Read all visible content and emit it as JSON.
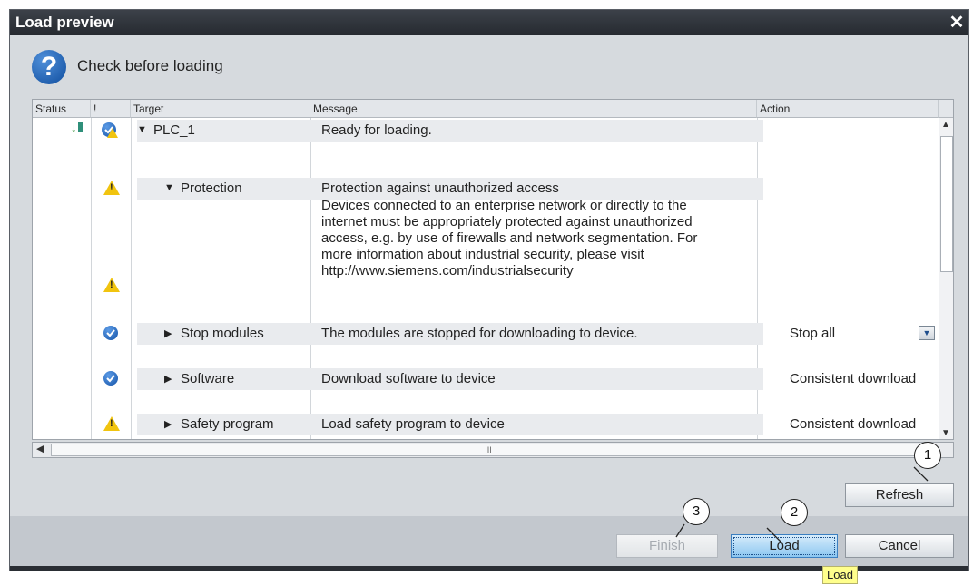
{
  "dialog": {
    "title": "Load preview",
    "close_glyph": "✕",
    "heading": "Check before loading",
    "heading_icon": "question-icon"
  },
  "table": {
    "columns": [
      "Status",
      "!",
      "Target",
      "Message",
      "Action"
    ],
    "rows": [
      {
        "target": "PLC_1",
        "message": "Ready for loading.",
        "status_icon": "download-icon",
        "flag": "ok-warning-icon"
      },
      {
        "target": "Protection",
        "message": "Protection against unauthorized access",
        "flag": "warning-icon"
      },
      {
        "message_lines": [
          "Devices connected to an enterprise network or directly to the",
          "internet must be appropriately protected against unauthorized",
          "access, e.g. by use of firewalls and network segmentation. For",
          "more information about industrial security, please visit",
          "http://www.siemens.com/industrialsecurity"
        ],
        "flag": "warning-icon"
      },
      {
        "target": "Stop modules",
        "message": "The modules are stopped for downloading to device.",
        "action": "Stop all",
        "flag": "check-icon"
      },
      {
        "target": "Software",
        "message": "Download software to device",
        "action": "Consistent download",
        "flag": "check-icon"
      },
      {
        "target": "Safety program",
        "message": "Load safety program to device",
        "action": "Consistent download",
        "flag": "warning-icon"
      }
    ],
    "hscroll_grip": "III"
  },
  "buttons": {
    "refresh": "Refresh",
    "finish": "Finish",
    "load": "Load",
    "cancel": "Cancel"
  },
  "tooltip": "Load",
  "callouts": [
    "1",
    "2",
    "3"
  ],
  "colors": {
    "titlebar": "#2b2f35",
    "warning": "#f1c40f",
    "ok": "#1554a8",
    "load_button": "#8cc7f1",
    "tooltip": "#ffff8c"
  }
}
